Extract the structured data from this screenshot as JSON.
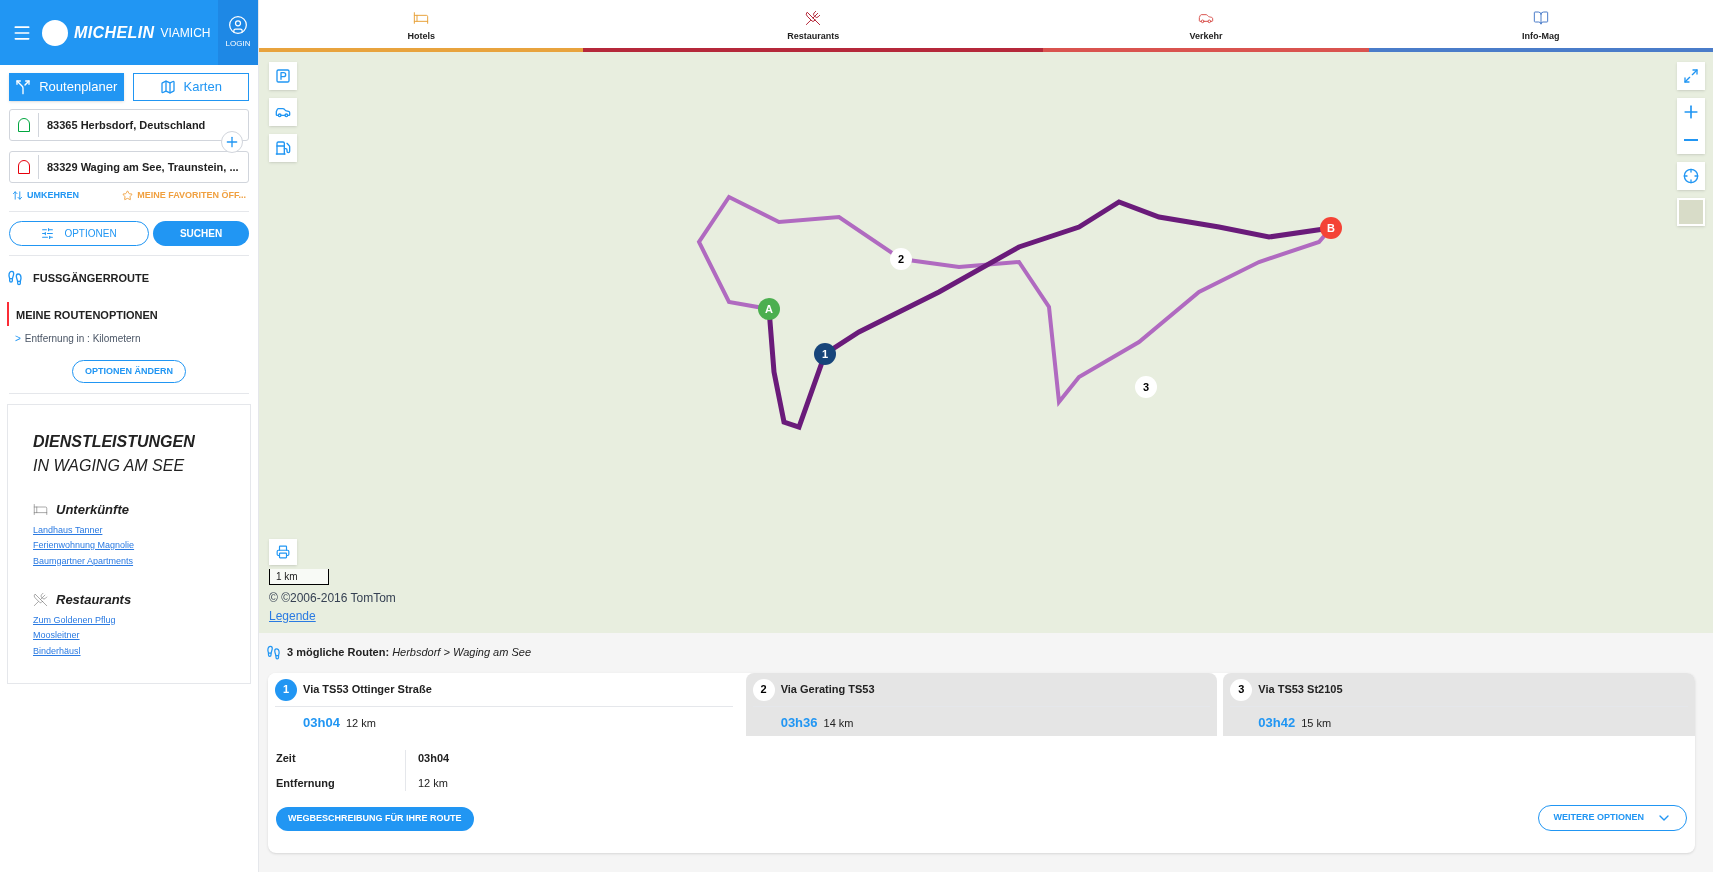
{
  "header": {
    "logo_brand": "MICHELIN",
    "logo_product": "VIAMICH",
    "login": "LOGIN"
  },
  "mode_tabs": [
    {
      "label": "Routenplaner",
      "kind": "route",
      "selected": true
    },
    {
      "label": "Karten",
      "kind": "map",
      "selected": false
    }
  ],
  "waypoints": [
    {
      "kind": "start",
      "value": "83365 Herbsdorf, Deutschland"
    },
    {
      "kind": "end",
      "value": "83329 Waging am See, Traunstein, ..."
    }
  ],
  "swap_link": "UMKEHREN",
  "favorites_link": "MEINE FAVORITEN ÖFF...",
  "options_button": "OPTIONEN",
  "search_button": "SUCHEN",
  "route_type": "FUSSGÄNGERROUTE",
  "route_options": {
    "title": "MEINE ROUTENOPTIONEN",
    "items": [
      {
        "marker": ">",
        "text": "Entfernung in : Kilometern"
      }
    ],
    "change_button": "OPTIONEN ÄNDERN"
  },
  "services": {
    "title": "DIENSTLEISTUNGEN",
    "subtitle": "IN WAGING AM SEE",
    "groups": [
      {
        "kind": "lodging",
        "title": "Unterkünfte",
        "links": [
          "Landhaus Tanner",
          "Ferienwohnung Magnolie",
          "Baumgartner Apartments"
        ]
      },
      {
        "kind": "food",
        "title": "Restaurants",
        "links": [
          "Zum Goldenen Pflug",
          "Moosleitner",
          "Binderhäusl"
        ]
      }
    ]
  },
  "top_tabs": [
    {
      "kind": "hotel",
      "label": "Hotels",
      "color": "#e8a33d"
    },
    {
      "kind": "food",
      "label": "Restaurants",
      "color": "#b5283a"
    },
    {
      "kind": "traffic",
      "label": "Verkehr",
      "color": "#d9534f"
    },
    {
      "kind": "book",
      "label": "Info-Mag",
      "color": "#4a7cc9"
    }
  ],
  "map": {
    "markers": [
      {
        "label": "A",
        "color": "#4caf50"
      },
      {
        "label": "B",
        "color": "#f44336"
      },
      {
        "label": "1",
        "color": "#17457a"
      },
      {
        "label": "2",
        "color": "#ffffff"
      },
      {
        "label": "3",
        "color": "#ffffff"
      }
    ],
    "scale": "1 km",
    "copyright": "© ©2006-2016 TomTom",
    "legend_link": "Legende"
  },
  "results": {
    "summary": "**3 mögliche Routen:** *Herbsdorf > Waging am See*",
    "routes": [
      {
        "number": "1",
        "name": "Via TS53 Ottinger Straße",
        "time": "03h04",
        "distance": "12 km",
        "selected": true
      },
      {
        "number": "2",
        "name": "Via Gerating TS53",
        "time": "03h36",
        "distance": "14 km",
        "selected": false
      },
      {
        "number": "3",
        "name": "Via TS53 St2105",
        "time": "03h42",
        "distance": "15 km",
        "selected": false
      }
    ],
    "details": [
      {
        "label": "Zeit",
        "value": "03h04",
        "kind": "bold"
      },
      {
        "label": "Entfernung",
        "value": "12 km",
        "kind": "plain"
      }
    ],
    "directions_button": "WEGBESCHREIBUNG FÜR IHRE ROUTE",
    "more_button": "WEITERE OPTIONEN"
  }
}
